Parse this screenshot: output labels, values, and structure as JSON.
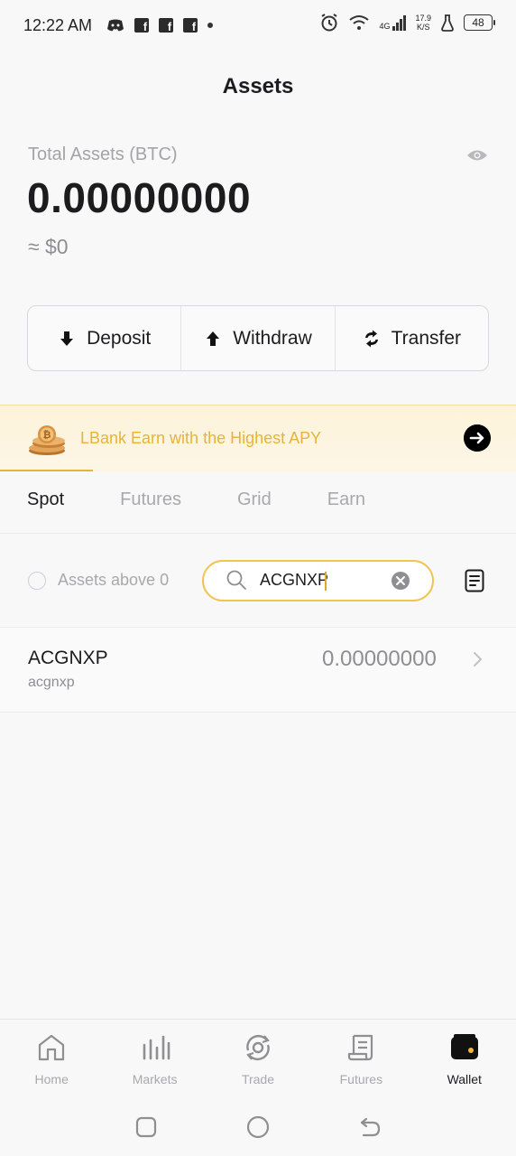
{
  "status_bar": {
    "time": "12:22 AM",
    "network": "4G",
    "speed_value": "17.9",
    "speed_unit": "K/S",
    "battery": "48",
    "fb_letter": "f"
  },
  "header": {
    "title": "Assets"
  },
  "summary": {
    "label": "Total Assets (BTC)",
    "value": "0.00000000",
    "usd": "≈ $0"
  },
  "actions": {
    "deposit": "Deposit",
    "withdraw": "Withdraw",
    "transfer": "Transfer"
  },
  "banner": {
    "text": "LBank Earn with the Highest APY"
  },
  "tabs": [
    {
      "label": "Spot",
      "active": true
    },
    {
      "label": "Futures",
      "active": false
    },
    {
      "label": "Grid",
      "active": false
    },
    {
      "label": "Earn",
      "active": false
    }
  ],
  "filter": {
    "assets_above_zero_label": "Assets above 0",
    "search_value": "ACGNXP"
  },
  "assets": [
    {
      "symbol": "ACGNXP",
      "name": "acgnxp",
      "amount": "0.00000000"
    }
  ],
  "bottom_nav": [
    {
      "label": "Home",
      "icon": "home-icon",
      "active": false
    },
    {
      "label": "Markets",
      "icon": "markets-icon",
      "active": false
    },
    {
      "label": "Trade",
      "icon": "trade-icon",
      "active": false
    },
    {
      "label": "Futures",
      "icon": "futures-icon",
      "active": false
    },
    {
      "label": "Wallet",
      "icon": "wallet-icon",
      "active": true
    }
  ],
  "colors": {
    "accent": "#e8b33a",
    "banner_bg": "#fdf4de",
    "text_primary": "#1c1c1e",
    "text_muted": "#a8a8ad"
  }
}
